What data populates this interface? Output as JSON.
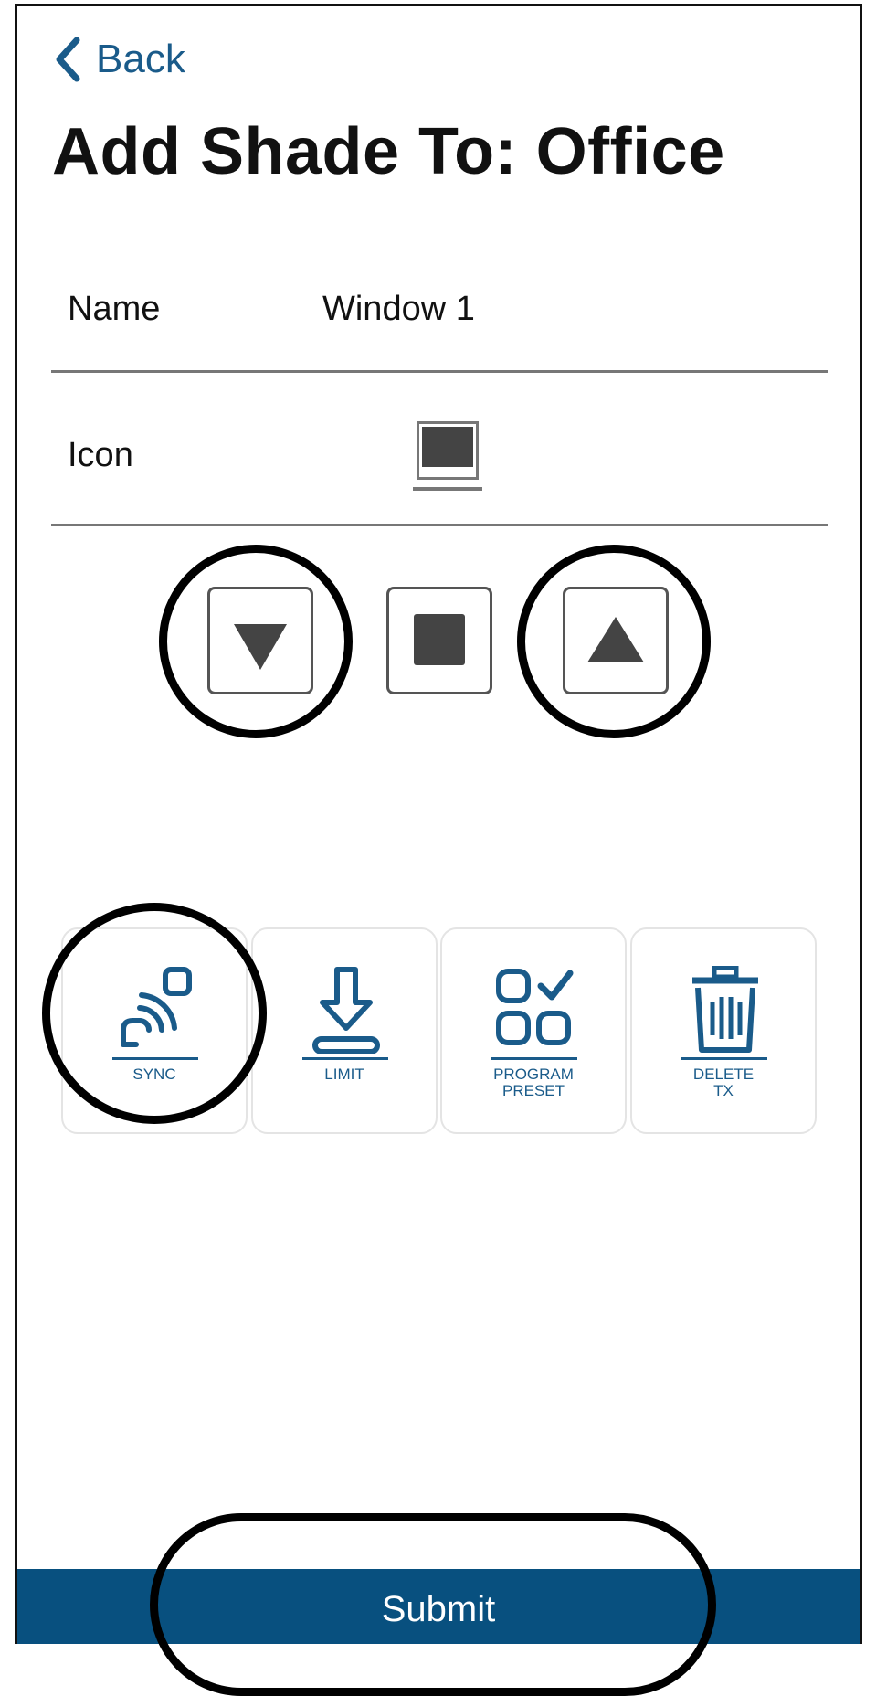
{
  "header": {
    "back_label": "Back",
    "title": "Add Shade To: Office"
  },
  "form": {
    "name_label": "Name",
    "name_value": "Window 1",
    "icon_label": "Icon",
    "icon_name": "shade-icon"
  },
  "controls": [
    {
      "id": "down",
      "icon": "triangle-down-icon"
    },
    {
      "id": "stop",
      "icon": "square-stop-icon"
    },
    {
      "id": "up",
      "icon": "triangle-up-icon"
    }
  ],
  "actions": [
    {
      "id": "sync",
      "label": "SYNC",
      "icon": "sync-signal-icon"
    },
    {
      "id": "limit",
      "label": "LIMIT",
      "icon": "limit-download-icon"
    },
    {
      "id": "program_preset",
      "label": "PROGRAM\nPRESET",
      "icon": "program-preset-grid-icon"
    },
    {
      "id": "delete_tx",
      "label": "DELETE\nTX",
      "icon": "trash-icon"
    }
  ],
  "footer": {
    "submit_label": "Submit"
  },
  "colors": {
    "accent": "#1a5b8a",
    "submit_bar": "#08507f",
    "highlight": "#000000"
  }
}
